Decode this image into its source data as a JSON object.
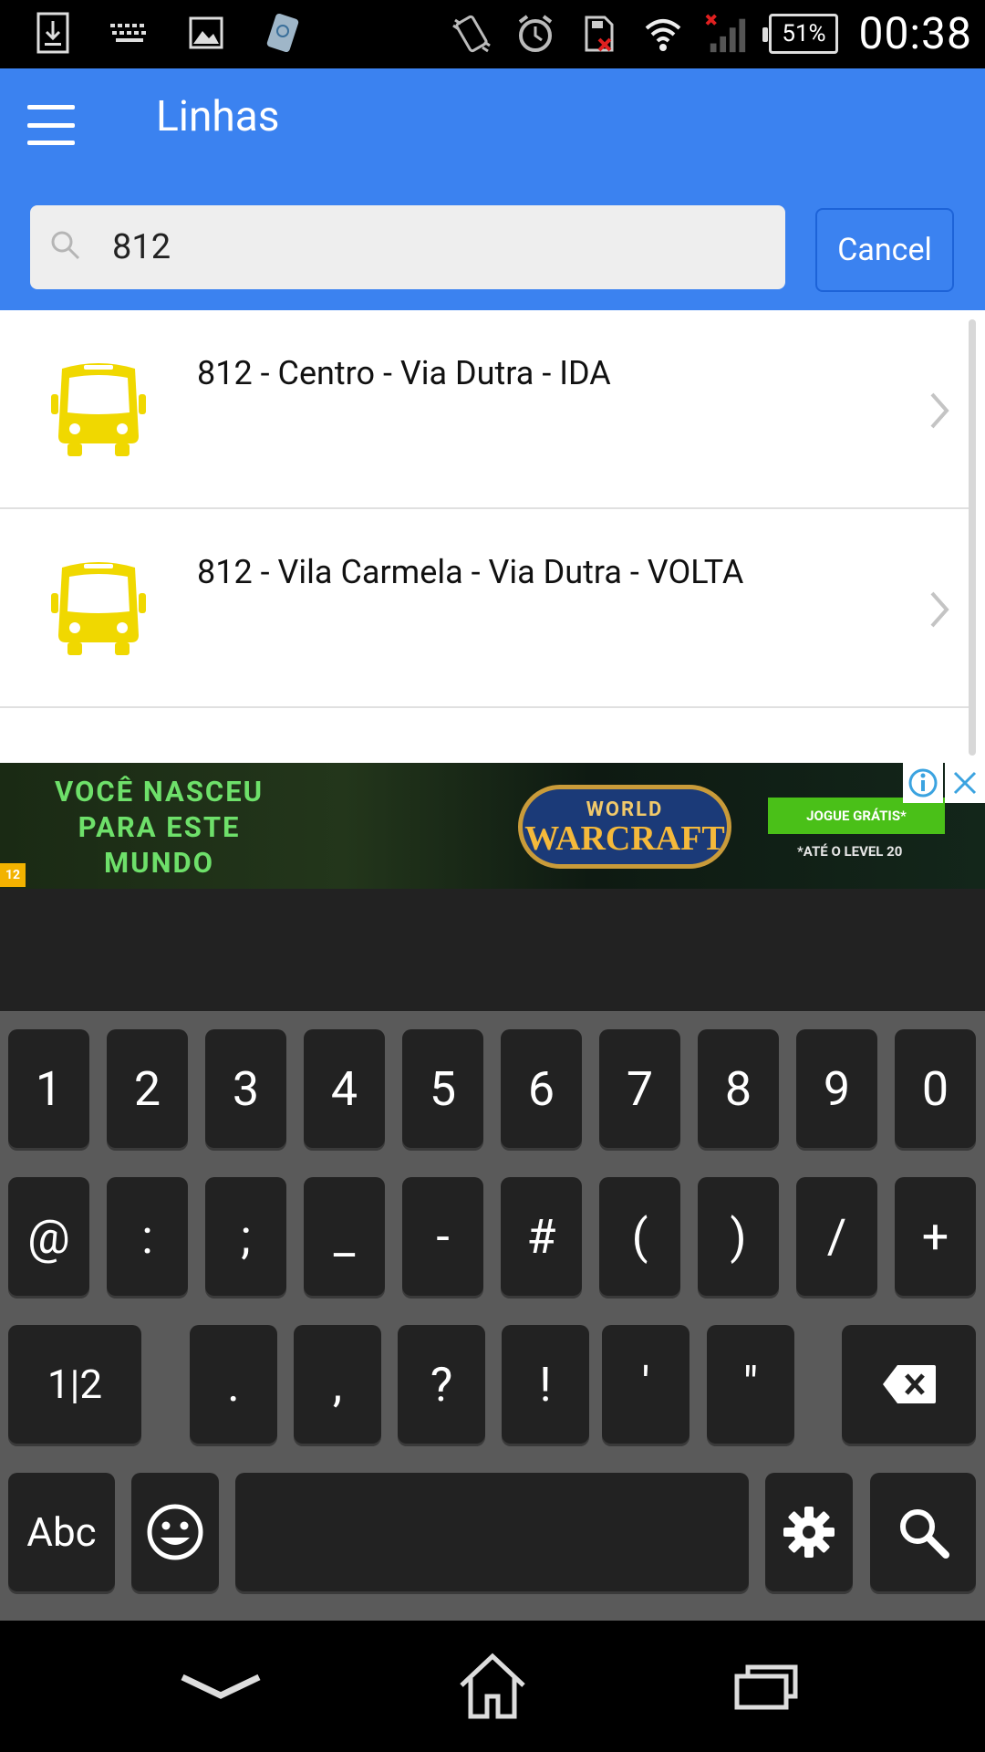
{
  "status_bar": {
    "battery": "51%",
    "time": "00:38"
  },
  "app_bar": {
    "title": "Linhas"
  },
  "search": {
    "value": "812",
    "cancel_label": "Cancel"
  },
  "results": [
    {
      "label": "812 - Centro - Via Dutra - IDA"
    },
    {
      "label": "812 - Vila Carmela - Via Dutra - VOLTA"
    }
  ],
  "ad": {
    "text_lines": [
      "VOCÊ NASCEU",
      "PARA ESTE",
      "MUNDO"
    ],
    "logo_top": "WORLD",
    "logo_bottom": "WARCRAFT",
    "cta": "JOGUE GRÁTIS*",
    "sub": "*ATÉ O LEVEL 20",
    "rating": "12"
  },
  "keyboard": {
    "row1": [
      "1",
      "2",
      "3",
      "4",
      "5",
      "6",
      "7",
      "8",
      "9",
      "0"
    ],
    "row2": [
      "@",
      ":",
      ";",
      "_",
      "-",
      "#",
      "(",
      ")",
      "/",
      "+"
    ],
    "row3": [
      ".",
      ",",
      "?",
      "!",
      "'",
      "\""
    ],
    "toggle": "1|2",
    "abc": "Abc"
  },
  "colors": {
    "accent": "#3b82f0",
    "bus_icon": "#f0d800",
    "keyboard_key": "#222222",
    "keyboard_bg": "#5a5a5a"
  }
}
